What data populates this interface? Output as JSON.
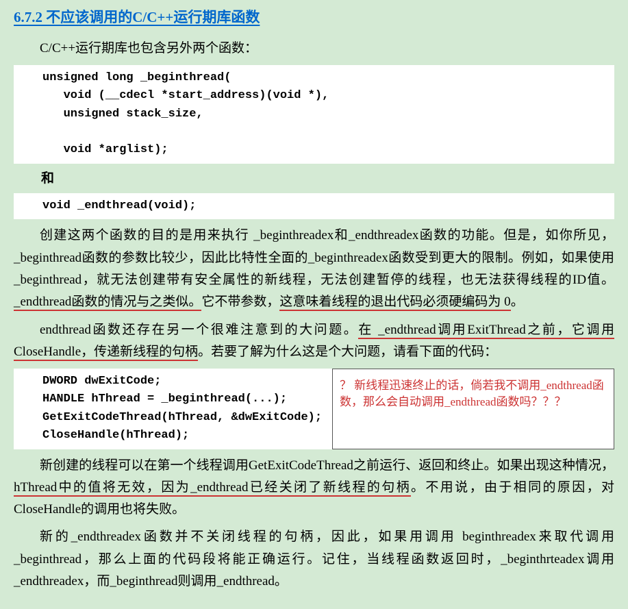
{
  "heading": "6.7.2  不应该调用的C/C++运行期库函数",
  "para_intro": "C/C++运行期库也包含另外两个函数：",
  "code1": "unsigned long _beginthread(\n   void (__cdecl *start_address)(void *),\n   unsigned stack_size,\n\n   void *arglist);",
  "label_and": "和",
  "code2": "void _endthread(void);",
  "para2_a": "创建这两个函数的目的是用来执行 _beginthreadex和_endthreadex函数的功能。但是，如你所见，_beginthread函数的参数比较少，因此比特性全面的_beginthreadex函数受到更大的限制。例如，如果使用 _beginthread，就无法创建带有安全属性的新线程，无法创建暂停的线程，也无法获得线程的ID值。",
  "para2_u1": "_endthread函数的情况与之类似。",
  "para2_b": "它不带参数，",
  "para2_u2": "这意味着线程的退出代码必须硬编码为 0",
  "para2_c": "。",
  "para3_a": "endthread函数还存在另一个很难注意到的大问题。",
  "para3_u1": "在 _endthread调用ExitThread之前，它调用CloseHandle，传递新线程的句柄",
  "para3_b": "。若要了解为什么这是个大问题，请看下面的代码：",
  "code3": "DWORD dwExitCode;\nHANDLE hThread = _beginthread(...);\nGetExitCodeThread(hThread, &dwExitCode);\nCloseHandle(hThread);",
  "red_note": "？ 新线程迅速终止的话，倘若我不调用_endthread函数，那么会自动调用_endthread函数吗？？？",
  "para4_a": "新创建的线程可以在第一个线程调用GetExitCodeThread之前运行、返回和终止。如果出现这种情况，",
  "para4_u1": "hThread中的值将无效，因为_endthread已经关闭了新线程的句柄",
  "para4_b": "。不用说，由于相同的原因，对CloseHandle的调用也将失败。",
  "para5": "新的_endthreadex函数并不关闭线程的句柄，因此，如果用调用 beginthreadex来取代调用_beginthread，那么上面的代码段将能正确运行。记住，当线程函数返回时，_beginthrteadex调用_endthreadex，而_beginthread则调用_endthread。"
}
